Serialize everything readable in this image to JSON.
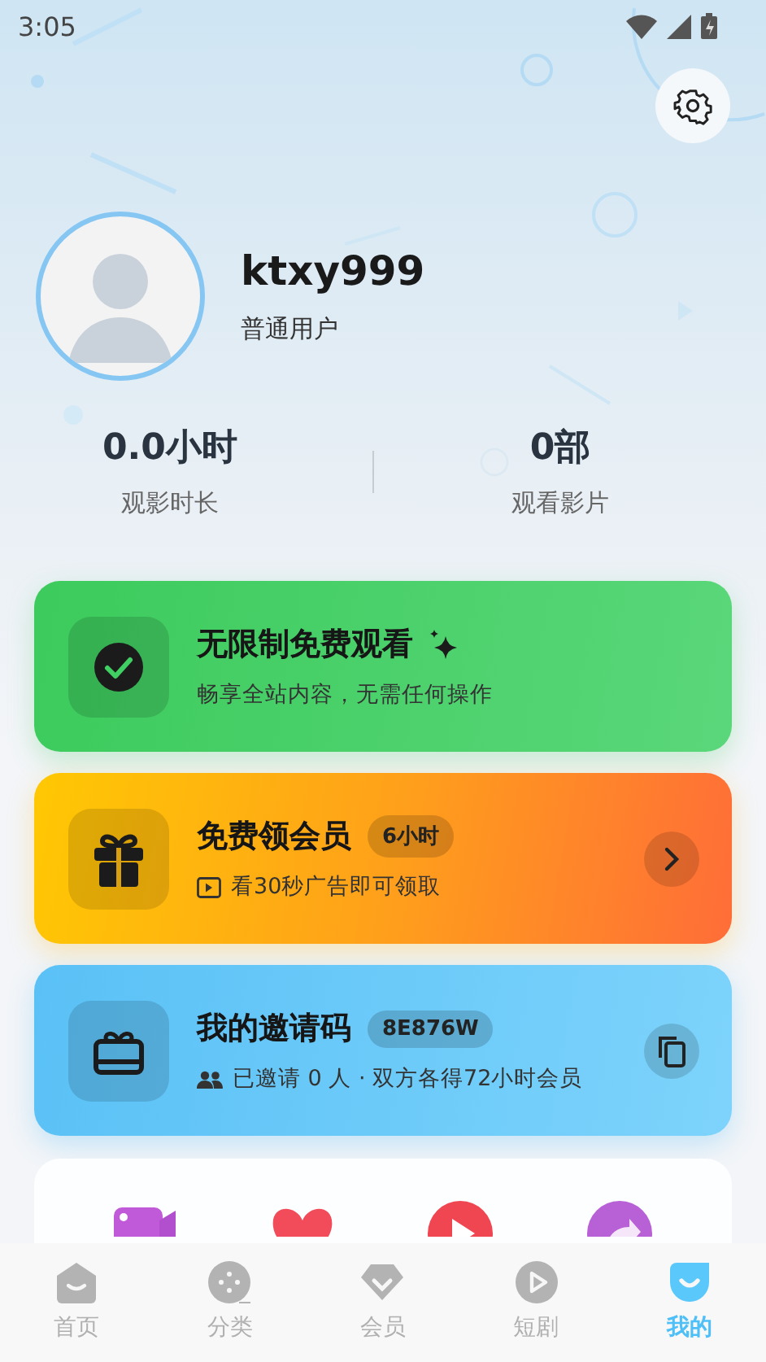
{
  "status_bar": {
    "time": "3:05"
  },
  "profile": {
    "username": "ktxy999",
    "level": "普通用户"
  },
  "stats": [
    {
      "value": "0.0小时",
      "label": "观影时长"
    },
    {
      "value": "0部",
      "label": "观看影片"
    }
  ],
  "cards": [
    {
      "kind": "free",
      "title": "无限制免费观看",
      "subtitle": "畅享全站内容，无需任何操作"
    },
    {
      "kind": "gift",
      "title": "免费领会员",
      "badge": "6小时",
      "subtitle": "看30秒广告即可领取"
    },
    {
      "kind": "invite",
      "title": "我的邀请码",
      "badge": "8E876W",
      "subtitle": "已邀请 0 人 · 双方各得72小时会员"
    }
  ],
  "bottom_nav": [
    {
      "label": "首页",
      "selected": false
    },
    {
      "label": "分类",
      "selected": false
    },
    {
      "label": "会员",
      "selected": false
    },
    {
      "label": "短剧",
      "selected": false
    },
    {
      "label": "我的",
      "selected": true
    }
  ]
}
